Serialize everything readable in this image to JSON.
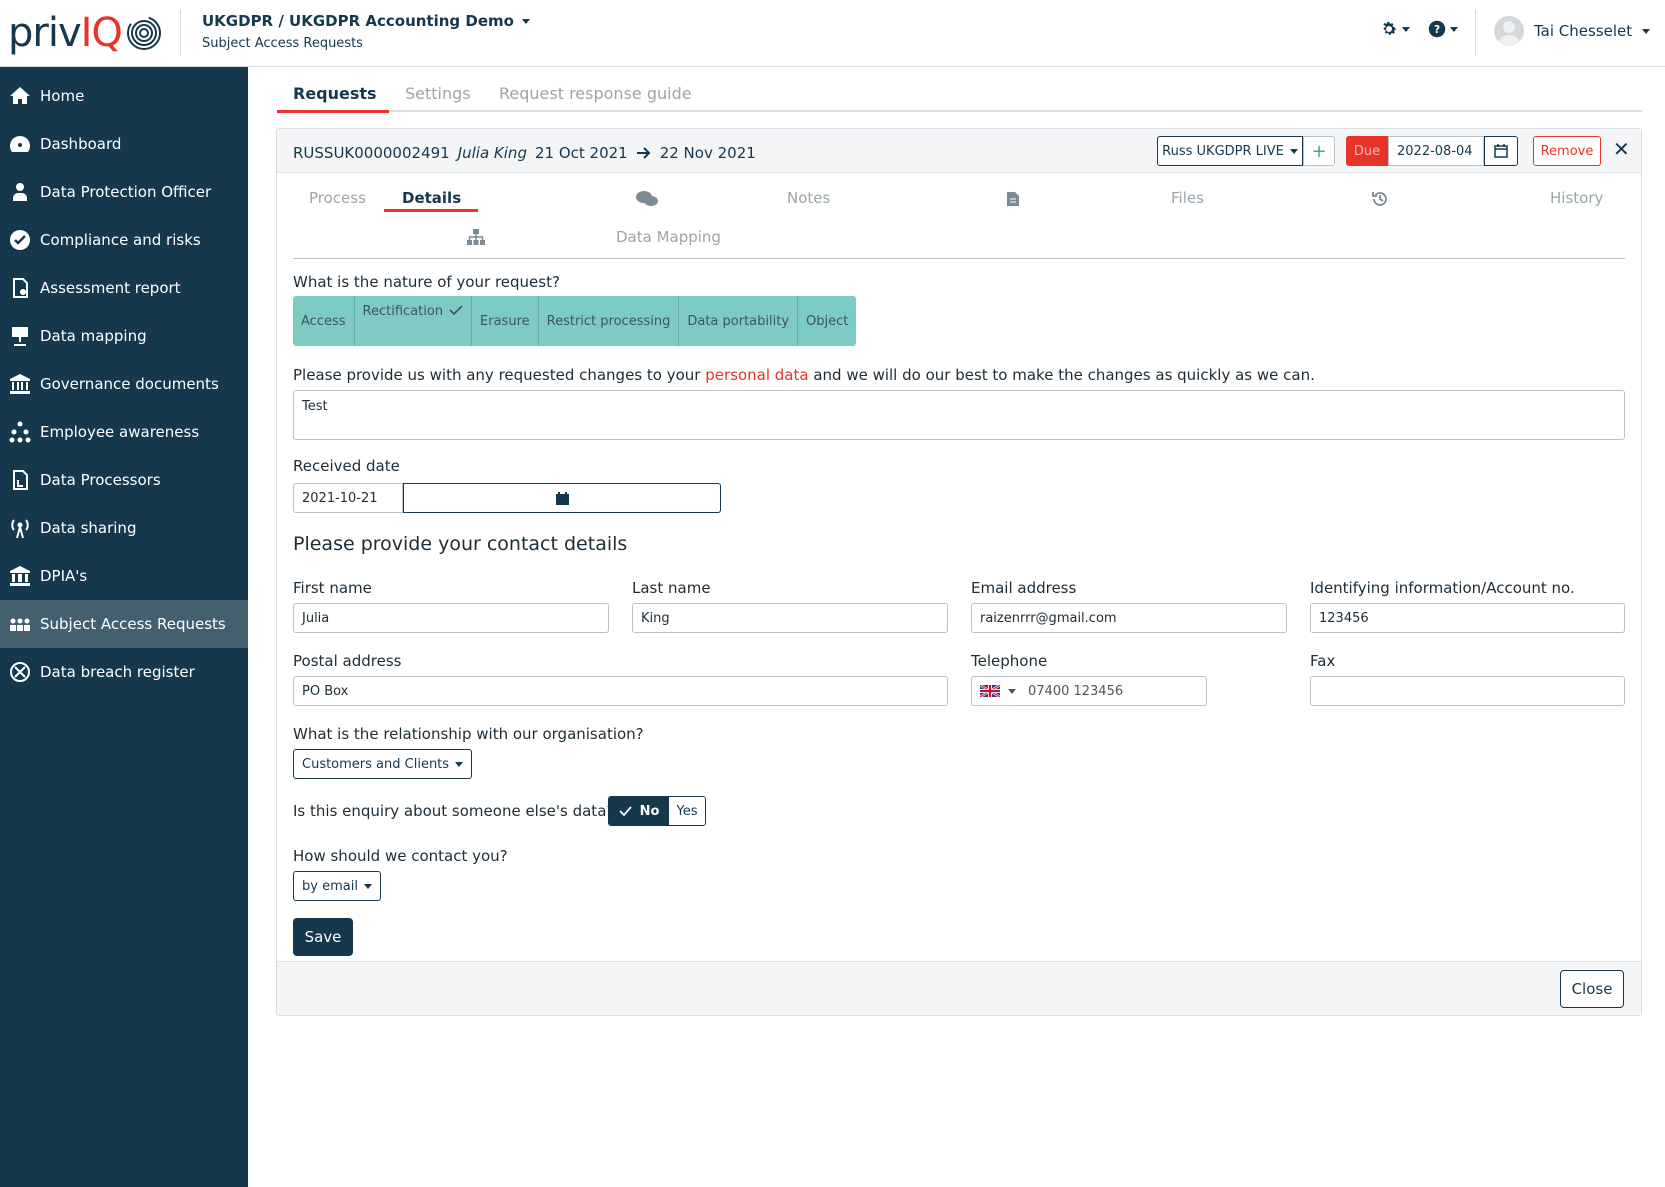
{
  "header": {
    "logo_priv": "priv",
    "logo_iq": "IQ",
    "org": "UKGDPR / UKGDPR Accounting Demo",
    "section": "Subject Access Requests",
    "user_name": "Tai Chesselet"
  },
  "sidebar": {
    "items": [
      {
        "label": "Home",
        "icon": "home-icon"
      },
      {
        "label": "Dashboard",
        "icon": "dashboard-icon"
      },
      {
        "label": "Data Protection Officer",
        "icon": "person-icon"
      },
      {
        "label": "Compliance and risks",
        "icon": "check-circle-icon"
      },
      {
        "label": "Assessment report",
        "icon": "report-icon"
      },
      {
        "label": "Data mapping",
        "icon": "data-mapping-icon"
      },
      {
        "label": "Governance documents",
        "icon": "institution-icon"
      },
      {
        "label": "Employee awareness",
        "icon": "hierarchy-icon"
      },
      {
        "label": "Data Processors",
        "icon": "processor-icon"
      },
      {
        "label": "Data sharing",
        "icon": "broadcast-icon"
      },
      {
        "label": "DPIA's",
        "icon": "dpia-icon"
      },
      {
        "label": "Subject Access Requests",
        "icon": "people-icon",
        "active": true
      },
      {
        "label": "Data breach register",
        "icon": "breach-icon"
      }
    ]
  },
  "main_tabs": {
    "requests": "Requests",
    "settings": "Settings",
    "guide": "Request response guide"
  },
  "request": {
    "id": "RUSSUK0000002491",
    "name": "Julia King",
    "date_from": "21 Oct 2021",
    "date_to": "22 Nov 2021",
    "env_select": "Russ UKGDPR LIVE",
    "plus": "+",
    "due_label": "Due",
    "due_date": "2022-08-04",
    "remove": "Remove",
    "close_x": "✕"
  },
  "subtabs": {
    "process": "Process",
    "details": "Details",
    "notes": "Notes",
    "files": "Files",
    "history": "History",
    "data_mapping": "Data Mapping"
  },
  "form": {
    "nature_question": "What is the nature of your request?",
    "nature_options": [
      "Access",
      "Rectification",
      "Erasure",
      "Restrict processing",
      "Data portability",
      "Object"
    ],
    "nature_selected": "Rectification",
    "changes_prefix": "Please provide us with any requested changes to your ",
    "changes_link": "personal data",
    "changes_suffix": " and we will do our best to make the changes as quickly as we can.",
    "changes_value": "Test",
    "received_label": "Received date",
    "received_value": "2021-10-21",
    "contact_title": "Please provide your contact details",
    "first_name_label": "First name",
    "first_name": "Julia",
    "last_name_label": "Last name",
    "last_name": "King",
    "email_label": "Email address",
    "email": "raizenrrr@gmail.com",
    "ident_label": "Identifying information/Account no.",
    "ident": "123456",
    "postal_label": "Postal address",
    "postal": "PO Box",
    "phone_label": "Telephone",
    "phone": "07400 123456",
    "fax_label": "Fax",
    "fax": "",
    "relationship_label": "What is the relationship with our organisation?",
    "relationship_value": "Customers and Clients",
    "someone_else_label": "Is this enquiry about someone else's data?",
    "no": "No",
    "yes": "Yes",
    "contact_method_label": "How should we contact you?",
    "contact_method_value": "by email",
    "save": "Save",
    "close": "Close"
  },
  "colors": {
    "navy": "#15384d",
    "accent_red": "#e8332a",
    "teal": "#7ecbc4"
  }
}
